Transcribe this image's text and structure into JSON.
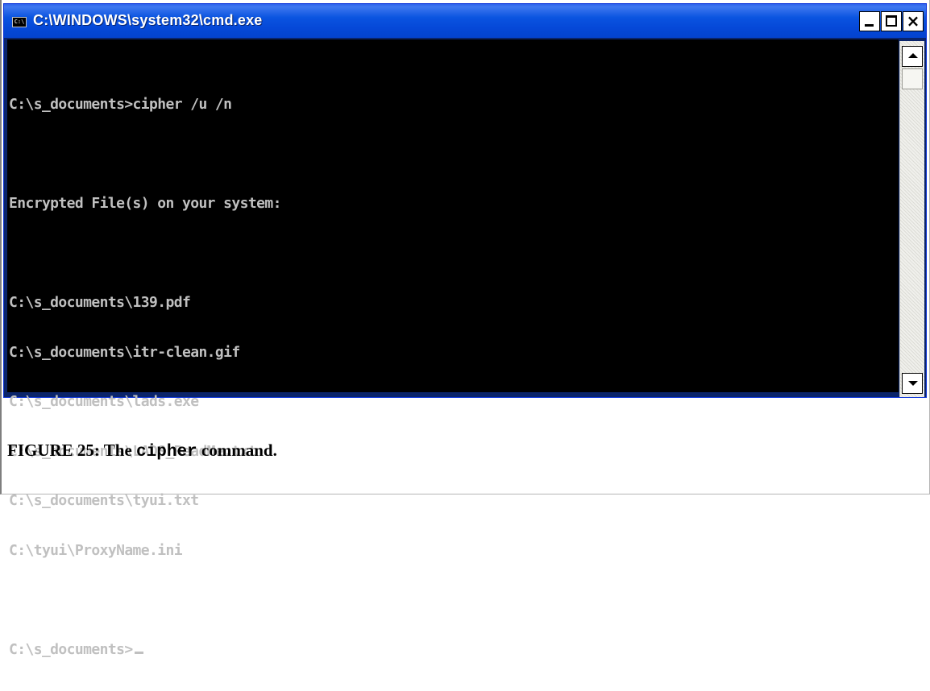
{
  "window": {
    "title": "C:\\WINDOWS\\system32\\cmd.exe",
    "icon_label": "C:\\"
  },
  "console": {
    "lines": [
      "C:\\s_documents>cipher /u /n",
      "",
      "Encrypted File(s) on your system:",
      "",
      "C:\\s_documents\\139.pdf",
      "C:\\s_documents\\itr-clean.gif",
      "C:\\s_documents\\lads.exe",
      "C:\\s_documents\\LADS_ReadMe.txt",
      "C:\\s_documents\\tyui.txt",
      "C:\\tyui\\ProxyName.ini",
      ""
    ],
    "prompt": "C:\\s_documents>"
  },
  "caption": {
    "prefix": "FIGURE 25: The ",
    "command": "cipher",
    "suffix": " command."
  },
  "icons": {
    "app": "cmd-console-icon",
    "minimize": "minimize-icon",
    "maximize": "maximize-icon",
    "close": "close-icon",
    "scroll_up": "arrow-up-icon",
    "scroll_down": "arrow-down-icon"
  }
}
